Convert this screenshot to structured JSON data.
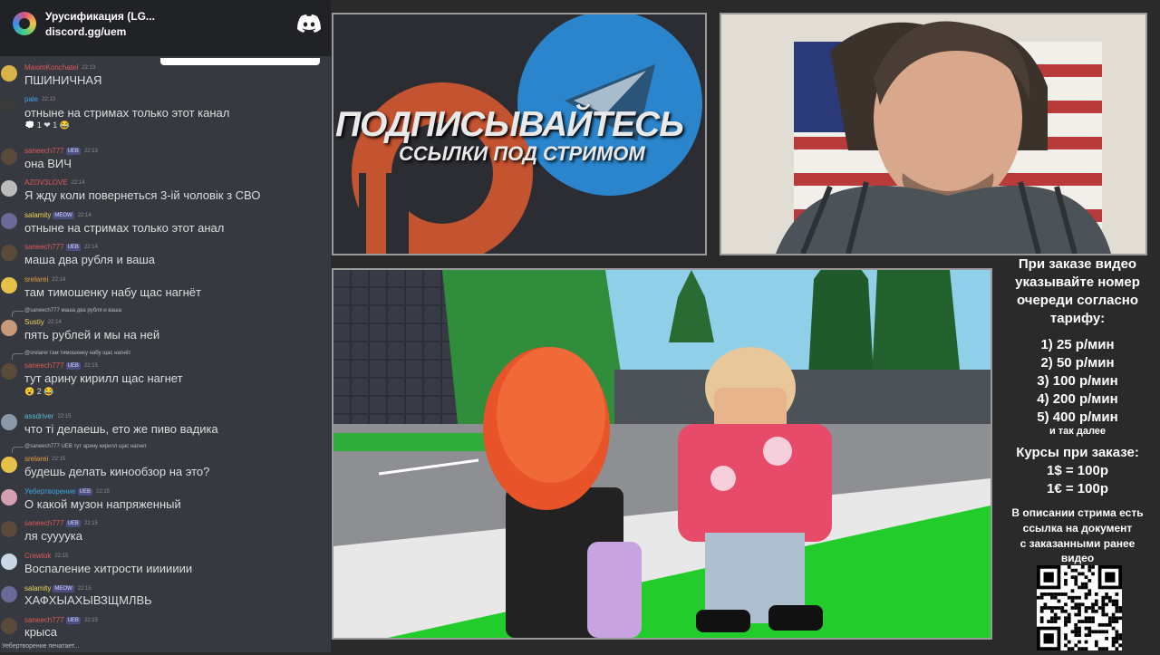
{
  "chat": {
    "server_name": "Урусификация (LG...",
    "server_link": "discord.gg/uem",
    "typing": "Уебертворение печатает...",
    "messages": [
      {
        "user": "MaximKonchatel",
        "time": "22:13",
        "text": "ПШИНИЧНАЯ",
        "color": "#e05a5a"
      },
      {
        "user": "pale",
        "time": "22:13",
        "text": "отныне  на стримах только этот канал",
        "color": "#3fa5e8",
        "reactions": "💭 1  ❤ 1  😂"
      },
      {
        "user": "saneech777",
        "tag": "UEB",
        "time": "22:13",
        "text": "она ВИЧ",
        "color": "#e05a5a"
      },
      {
        "user": "AZOV3LOVE",
        "time": "22:14",
        "text": "Я жду коли повернеться 3-ій чоловік з СВО",
        "color": "#e05a5a"
      },
      {
        "user": "salamity",
        "tag": "MEOW",
        "time": "22:14",
        "text": "отныне  на стримах только этот анал",
        "color": "#e8d65a"
      },
      {
        "user": "saneech777",
        "tag": "UEB",
        "time": "22:14",
        "text": "маша два рубля и ваша",
        "color": "#e05a5a"
      },
      {
        "user": "srelarei",
        "time": "22:14",
        "text": "там тимошенку набу щас нагнёт",
        "color": "#e0a040"
      },
      {
        "reply": "@saneech777 маша два рубля и ваша",
        "user": "Sustiy",
        "time": "22:14",
        "text": "пять рублей и мы на ней",
        "color": "#e8d65a"
      },
      {
        "reply": "@srelarei там тимошенку набу щас нагнёт",
        "user": "saneech777",
        "tag": "UEB",
        "time": "22:15",
        "text": "тут арину кирилл щас нагнет",
        "color": "#e05a5a",
        "reactions": "😮 2  😂"
      },
      {
        "user": "assdriver",
        "time": "22:15",
        "text": "что ті делаешь, ето же пиво вадика",
        "color": "#5ab8d8"
      },
      {
        "reply": "@saneech777 UEB тут арину кирилл щас нагнет",
        "user": "srelarei",
        "time": "22:15",
        "text": "будешь делать кинообзор на это?",
        "color": "#e0a040"
      },
      {
        "user": "Уебертворение",
        "tag": "UEB",
        "time": "22:15",
        "text": "О какой музон напряженный",
        "color": "#3fa5e8"
      },
      {
        "user": "saneech777",
        "tag": "UEB",
        "time": "22:15",
        "text": "ля суууука",
        "color": "#e05a5a"
      },
      {
        "user": "Crewtok",
        "time": "22:15",
        "text": "Воспаление хитрости иииииии",
        "color": "#e05a5a"
      },
      {
        "user": "salamity",
        "tag": "MEOW",
        "time": "22:15",
        "text": "ХАФХЫАХЫВЗЩМЛВЬ",
        "color": "#e8d65a"
      },
      {
        "user": "saneech777",
        "tag": "UEB",
        "time": "22:15",
        "text": "крыса",
        "color": "#e05a5a"
      }
    ]
  },
  "promo": {
    "title": "ПОДПИСЫВАЙТЕСЬ",
    "subtitle": "ССЫЛКИ ПОД СТРИМОМ"
  },
  "info": {
    "intro": [
      "При заказе видео",
      "указывайте номер",
      "очереди согласно",
      "тарифу:"
    ],
    "tariffs": [
      "1) 25 р/мин",
      "2) 50 р/мин",
      "3) 100 р/мин",
      "4) 200 р/мин",
      "5) 400 р/мин"
    ],
    "etc": "и так далее",
    "rates_title": "Курсы при заказе:",
    "rates": [
      "1$ = 100р",
      "1€ = 100р"
    ],
    "note": [
      "В описании стрима есть",
      "ссылка на документ",
      "с заказанными ранее",
      "видео"
    ]
  },
  "colors": {
    "chat_bg": "#36393f",
    "header_bg": "#202225",
    "accent": "#5865f2"
  }
}
